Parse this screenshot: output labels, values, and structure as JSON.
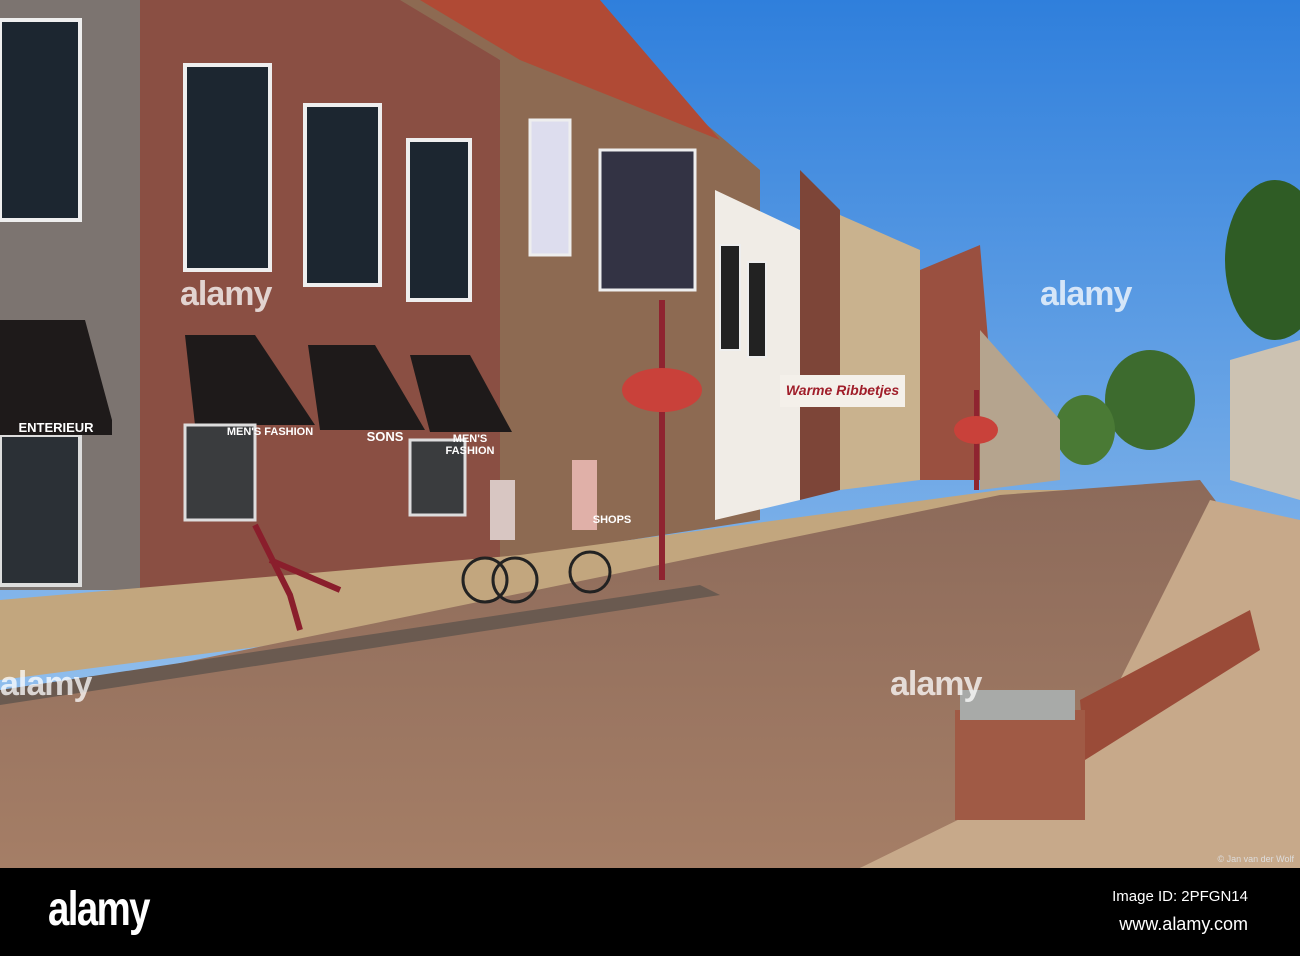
{
  "photo": {
    "watermark": "alamy",
    "credit": "© Jan van der Wolf",
    "signs": {
      "interieur": "ENTERIEUR",
      "mens_fashion_1": "MEN'S FASHION",
      "sons": "SONS",
      "mens_fashion_2": "MEN'S FASHION",
      "shops": "SHOPS",
      "banner": "Warme Ribbetjes"
    }
  },
  "footer": {
    "logo": "alamy",
    "image_id": "Image ID: 2PFGN14",
    "url": "www.alamy.com"
  },
  "colors": {
    "sky": "#3f8de0",
    "brick": "#8a5a4a",
    "pavement": "#a07a62",
    "awning": "#1e1a1a"
  }
}
